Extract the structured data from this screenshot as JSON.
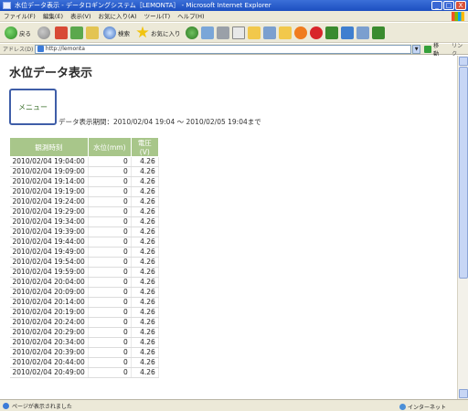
{
  "window": {
    "title": "水位データ表示 - データロギングシステム［LEMONTA］ - Microsoft Internet Explorer",
    "buttons": [
      "_",
      "□",
      "X"
    ]
  },
  "menubar": {
    "items": [
      "ファイル(F)",
      "編集(E)",
      "表示(V)",
      "お気に入り(A)",
      "ツール(T)",
      "ヘルプ(H)"
    ]
  },
  "toolbar": {
    "back_label": "戻る",
    "search_label": "検索",
    "favorites_label": "お気に入り"
  },
  "addressbar": {
    "label": "アドレス(D)",
    "url": "http://lemonta",
    "go_label": "移動",
    "links_label": "リンク"
  },
  "page": {
    "title": "水位データ表示",
    "menu_button": "メニュー",
    "period_label": "データ表示期間：",
    "period_start": "2010/02/04 19:04",
    "period_separator": "～",
    "period_end": "2010/02/05 19:04まで"
  },
  "table": {
    "headers": [
      "観測時刻",
      "水位(mm)",
      "電圧(V)"
    ],
    "rows": [
      [
        "2010/02/04 19:04:00",
        "0",
        "4.26"
      ],
      [
        "2010/02/04 19:09:00",
        "0",
        "4.26"
      ],
      [
        "2010/02/04 19:14:00",
        "0",
        "4.26"
      ],
      [
        "2010/02/04 19:19:00",
        "0",
        "4.26"
      ],
      [
        "2010/02/04 19:24:00",
        "0",
        "4.26"
      ],
      [
        "2010/02/04 19:29:00",
        "0",
        "4.26"
      ],
      [
        "2010/02/04 19:34:00",
        "0",
        "4.26"
      ],
      [
        "2010/02/04 19:39:00",
        "0",
        "4.26"
      ],
      [
        "2010/02/04 19:44:00",
        "0",
        "4.26"
      ],
      [
        "2010/02/04 19:49:00",
        "0",
        "4.26"
      ],
      [
        "2010/02/04 19:54:00",
        "0",
        "4.26"
      ],
      [
        "2010/02/04 19:59:00",
        "0",
        "4.26"
      ],
      [
        "2010/02/04 20:04:00",
        "0",
        "4.26"
      ],
      [
        "2010/02/04 20:09:00",
        "0",
        "4.26"
      ],
      [
        "2010/02/04 20:14:00",
        "0",
        "4.26"
      ],
      [
        "2010/02/04 20:19:00",
        "0",
        "4.26"
      ],
      [
        "2010/02/04 20:24:00",
        "0",
        "4.26"
      ],
      [
        "2010/02/04 20:29:00",
        "0",
        "4.26"
      ],
      [
        "2010/02/04 20:34:00",
        "0",
        "4.26"
      ],
      [
        "2010/02/04 20:39:00",
        "0",
        "4.26"
      ],
      [
        "2010/02/04 20:44:00",
        "0",
        "4.26"
      ],
      [
        "2010/02/04 20:49:00",
        "0",
        "4.26"
      ]
    ]
  },
  "statusbar": {
    "text": "ページが表示されました",
    "zone": "インターネット"
  },
  "colors": {
    "header_bg": "#a8c68a",
    "titlebar": "#1c4fc0",
    "menu_border": "#3f5ea8"
  }
}
